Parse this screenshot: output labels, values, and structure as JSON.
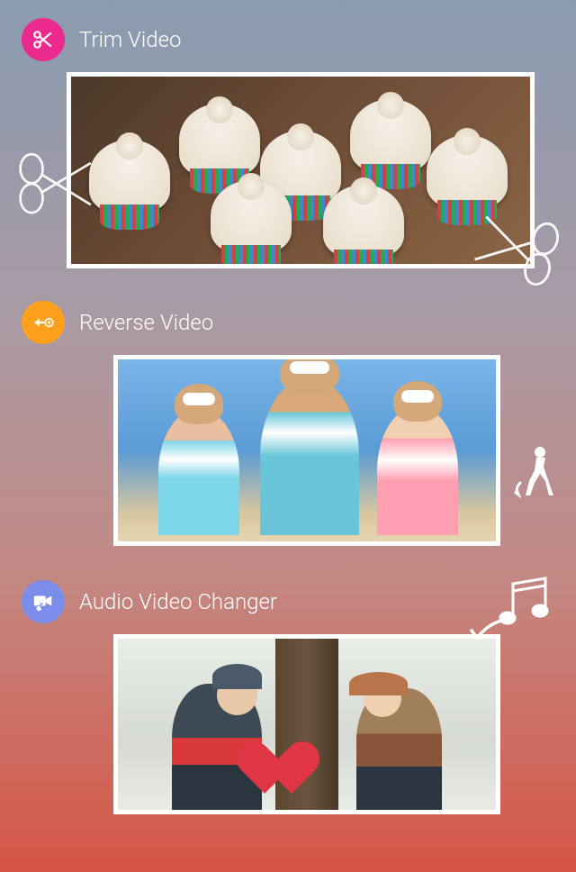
{
  "sections": [
    {
      "icon": "scissors-icon",
      "iconColor": "#ec2a8e",
      "label": "Trim Video"
    },
    {
      "icon": "reverse-icon",
      "iconColor": "#ffa01c",
      "label": "Reverse Video"
    },
    {
      "icon": "video-audio-icon",
      "iconColor": "#7a8de8",
      "label": "Audio Video Changer"
    }
  ]
}
